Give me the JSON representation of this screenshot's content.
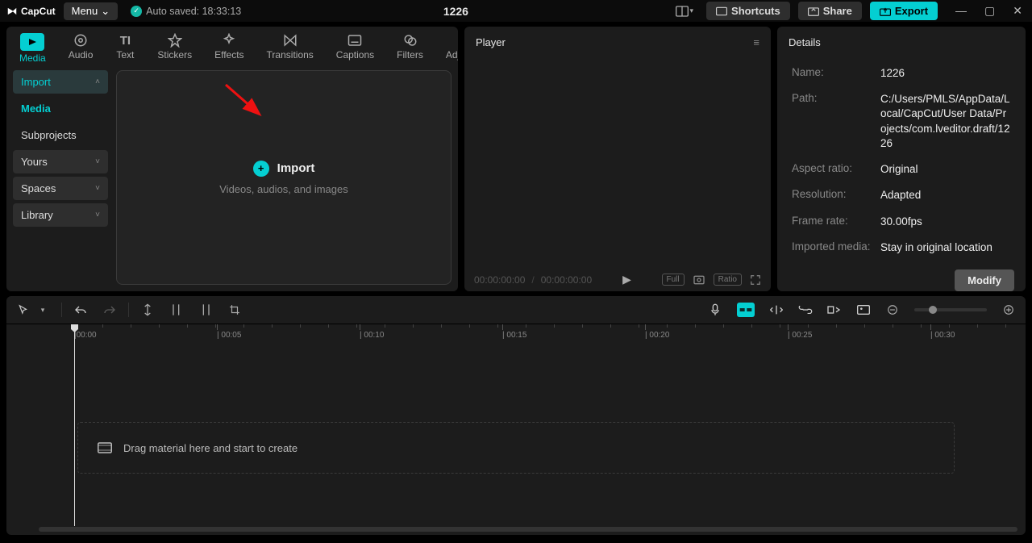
{
  "app": {
    "name": "CapCut"
  },
  "menu": {
    "label": "Menu"
  },
  "autosave": {
    "text": "Auto saved: 18:33:13"
  },
  "project": {
    "title": "1226"
  },
  "header": {
    "shortcuts": "Shortcuts",
    "share": "Share",
    "export": "Export"
  },
  "mediaTabs": [
    {
      "label": "Media",
      "active": true
    },
    {
      "label": "Audio"
    },
    {
      "label": "Text"
    },
    {
      "label": "Stickers"
    },
    {
      "label": "Effects"
    },
    {
      "label": "Transitions"
    },
    {
      "label": "Captions"
    },
    {
      "label": "Filters"
    },
    {
      "label": "Adjustment"
    }
  ],
  "mediaSidebar": {
    "import": "Import",
    "media": "Media",
    "subprojects": "Subprojects",
    "yours": "Yours",
    "spaces": "Spaces",
    "library": "Library"
  },
  "importZone": {
    "title": "Import",
    "subtitle": "Videos, audios, and images"
  },
  "player": {
    "title": "Player",
    "timecode_current": "00:00:00:00",
    "timecode_total": "00:00:00:00",
    "full": "Full",
    "ratio": "Ratio"
  },
  "details": {
    "title": "Details",
    "name_label": "Name:",
    "name_value": "1226",
    "path_label": "Path:",
    "path_value": "C:/Users/PMLS/AppData/Local/CapCut/User Data/Projects/com.lveditor.draft/1226",
    "aspect_label": "Aspect ratio:",
    "aspect_value": "Original",
    "res_label": "Resolution:",
    "res_value": "Adapted",
    "fps_label": "Frame rate:",
    "fps_value": "30.00fps",
    "imported_label": "Imported media:",
    "imported_value": "Stay in original location",
    "modify": "Modify"
  },
  "timeline": {
    "ticks": [
      "00:00",
      "00:05",
      "00:10",
      "00:15",
      "00:20",
      "00:25",
      "00:30"
    ],
    "drag_hint": "Drag material here and start to create"
  }
}
